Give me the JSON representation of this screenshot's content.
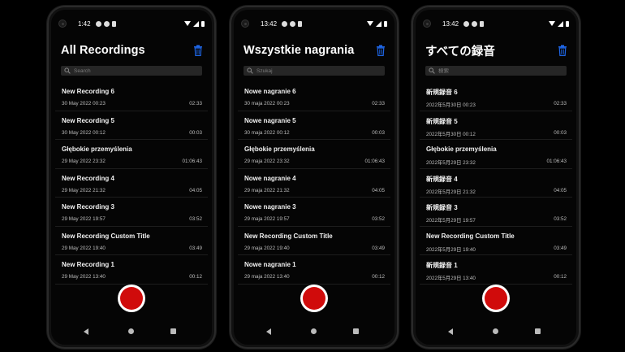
{
  "colors": {
    "accent": "#1e66e6",
    "record": "#d00b0b",
    "background": "#000000"
  },
  "phones": [
    {
      "status": {
        "time": "1:42"
      },
      "title": "All Recordings",
      "search_placeholder": "Search",
      "recordings": [
        {
          "name": "New Recording 6",
          "date": "30 May 2022 00:23",
          "duration": "02:33"
        },
        {
          "name": "New Recording 5",
          "date": "30 May 2022 00:12",
          "duration": "00:03"
        },
        {
          "name": "Głębokie przemyślenia",
          "date": "29 May 2022 23:32",
          "duration": "01:06:43"
        },
        {
          "name": "New Recording 4",
          "date": "29 May 2022 21:32",
          "duration": "04:05"
        },
        {
          "name": "New Recording 3",
          "date": "29 May 2022 19:57",
          "duration": "03:52"
        },
        {
          "name": "New Recording Custom Title",
          "date": "29 May 2022 19:40",
          "duration": "03:49"
        },
        {
          "name": "New Recording 1",
          "date": "29 May 2022 13:40",
          "duration": "00:12"
        }
      ]
    },
    {
      "status": {
        "time": "13:42"
      },
      "title": "Wszystkie nagrania",
      "search_placeholder": "Szukaj",
      "recordings": [
        {
          "name": "Nowe nagranie 6",
          "date": "30 maja 2022 00:23",
          "duration": "02:33"
        },
        {
          "name": "Nowe nagranie 5",
          "date": "30 maja 2022 00:12",
          "duration": "00:03"
        },
        {
          "name": "Głębokie przemyślenia",
          "date": "29 maja 2022 23:32",
          "duration": "01:06:43"
        },
        {
          "name": "Nowe nagranie 4",
          "date": "29 maja 2022 21:32",
          "duration": "04:05"
        },
        {
          "name": "Nowe nagranie 3",
          "date": "29 maja 2022 19:57",
          "duration": "03:52"
        },
        {
          "name": "New Recording Custom Title",
          "date": "29 maja 2022 19:40",
          "duration": "03:49"
        },
        {
          "name": "Nowe nagranie 1",
          "date": "29 maja 2022 13:40",
          "duration": "00:12"
        }
      ]
    },
    {
      "status": {
        "time": "13:42"
      },
      "title": "すべての録音",
      "search_placeholder": "検索",
      "recordings": [
        {
          "name": "新規録音 6",
          "date": "2022年5月30日 00:23",
          "duration": "02:33"
        },
        {
          "name": "新規録音 5",
          "date": "2022年5月30日 00:12",
          "duration": "00:03"
        },
        {
          "name": "Głębokie przemyślenia",
          "date": "2022年5月29日 23:32",
          "duration": "01:06:43"
        },
        {
          "name": "新規録音 4",
          "date": "2022年5月29日 21:32",
          "duration": "04:05"
        },
        {
          "name": "新規録音 3",
          "date": "2022年5月29日 19:57",
          "duration": "03:52"
        },
        {
          "name": "New Recording Custom Title",
          "date": "2022年5月29日 19:40",
          "duration": "03:49"
        },
        {
          "name": "新規録音 1",
          "date": "2022年5月29日 13:40",
          "duration": "00:12"
        }
      ]
    }
  ]
}
